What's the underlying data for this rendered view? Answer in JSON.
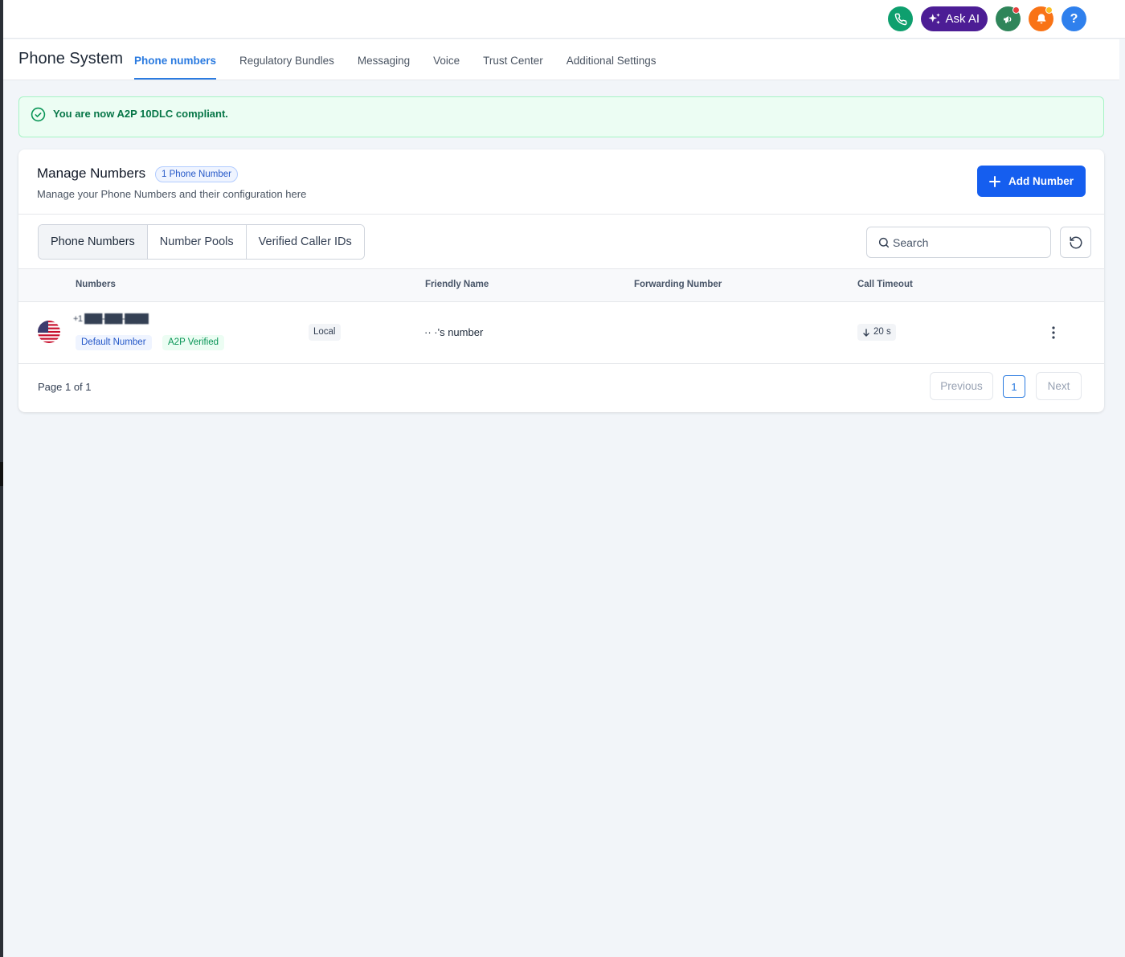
{
  "topbar": {
    "ask_ai_label": "Ask AI",
    "help_label": "?",
    "icons": [
      "phone-icon",
      "sparkle-icon",
      "megaphone-icon",
      "bell-icon",
      "help-icon"
    ],
    "colors": {
      "phone": "#0e9f6e",
      "ask_ai": "#4c1d95",
      "announce": "#2f855a",
      "bell": "#f97316",
      "help": "#2f80ed"
    }
  },
  "nav": {
    "title": "Phone System",
    "tabs": [
      {
        "label": "Phone numbers",
        "active": true
      },
      {
        "label": "Regulatory Bundles",
        "active": false
      },
      {
        "label": "Messaging",
        "active": false
      },
      {
        "label": "Voice",
        "active": false
      },
      {
        "label": "Trust Center",
        "active": false
      },
      {
        "label": "Additional Settings",
        "active": false
      }
    ]
  },
  "banner": {
    "text": "You are now A2P 10DLC compliant."
  },
  "manage": {
    "title": "Manage Numbers",
    "count_badge": "1 Phone Number",
    "subtitle": "Manage your Phone Numbers and their configuration here",
    "add_button": "Add Number",
    "segments": [
      {
        "label": "Phone Numbers",
        "active": true
      },
      {
        "label": "Number Pools",
        "active": false
      },
      {
        "label": "Verified Caller IDs",
        "active": false
      }
    ],
    "search_placeholder": "Search"
  },
  "table": {
    "headers": [
      "Numbers",
      "Friendly Name",
      "Forwarding Number",
      "Call Timeout"
    ],
    "rows": [
      {
        "number": "+1 ███-███-████",
        "tags": [
          "Default Number",
          "A2P Verified"
        ],
        "type": "Local",
        "friendly_name": "·· ·'s number",
        "forwarding_number": "",
        "call_timeout": "20 s"
      }
    ]
  },
  "pagination": {
    "page_text": "Page 1 of 1",
    "previous": "Previous",
    "current": "1",
    "next": "Next"
  }
}
